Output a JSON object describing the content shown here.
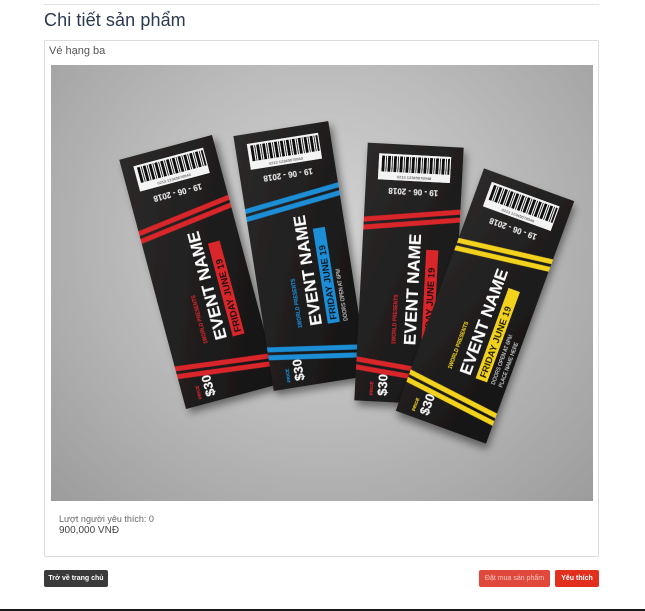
{
  "page": {
    "title": "Chi tiết sản phẩm"
  },
  "product": {
    "name": "Vé hạng ba",
    "likes_label": "Lượt người yêu thích: 0",
    "price": "900,000 VNĐ",
    "image": {
      "tickets": [
        {
          "accent": "#d8262c",
          "barcode": "0213 12345678948",
          "date": "19 - 06 - 2018",
          "event": "EVENT NAME",
          "date_line": "FRIDAY  JUNE 19",
          "presents": "1WORLD PRESENTS",
          "doors": "",
          "place": "",
          "price_label": "PRICE",
          "price": "$30"
        },
        {
          "accent": "#1a8ed6",
          "barcode": "0213 12345678948",
          "date": "19 - 06 - 2018",
          "event": "EVENT NAME",
          "date_line": "FRIDAY  JUNE 19",
          "presents": "1WORLD PRESENTS",
          "doors": "DOORS OPEN AT 6PM",
          "place": "",
          "price_label": "PRICE",
          "price": "$30"
        },
        {
          "accent": "#d8262c",
          "barcode": "0213 12345678948",
          "date": "19 - 06 - 2018",
          "event": "EVENT NAME",
          "date_line": "FRIDAY  JUNE 19",
          "presents": "1WORLD PRESENTS",
          "doors": "",
          "place": "",
          "price_label": "PRICE",
          "price": "$30"
        },
        {
          "accent": "#f2d21b",
          "barcode": "0213 12345678948",
          "date": "19 - 06 - 2018",
          "event": "EVENT NAME",
          "date_line": "FRIDAY  JUNE 19",
          "presents": "1WORLD PRESENTS",
          "doors": "DOORS OPEN AT 6PM",
          "place": "PLACE NAME HERE",
          "price_label": "PRICE",
          "price": "$30"
        }
      ]
    }
  },
  "actions": {
    "home_label": "Trở về trang chủ",
    "buy_label": "Đặt mua sản phẩm",
    "favorite_label": "Yêu thích"
  },
  "colors": {
    "title": "#2b3a4f",
    "buy_button": "#e0483b",
    "favorite_button": "#e2301f",
    "home_button": "#3a3a3a"
  }
}
